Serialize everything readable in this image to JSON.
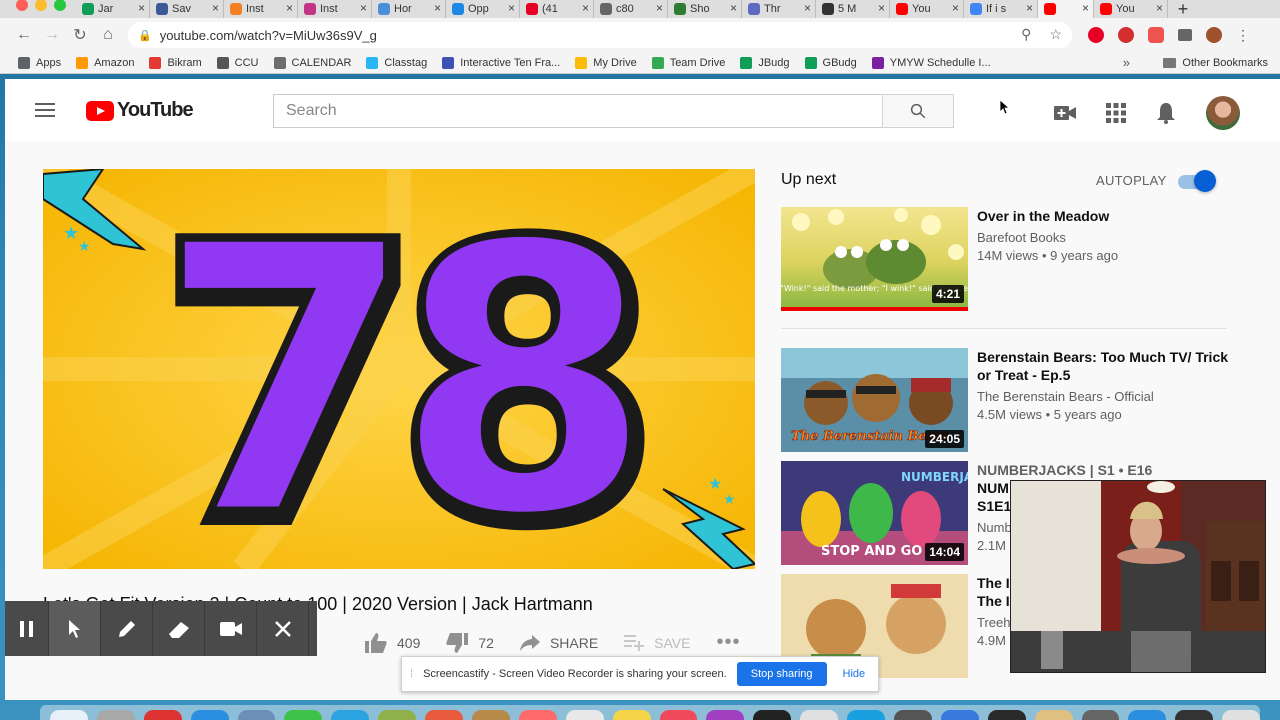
{
  "browser": {
    "tabs": [
      {
        "label": "Jar",
        "color": "#0f9d58"
      },
      {
        "label": "Sav",
        "color": "#3b5998"
      },
      {
        "label": "Inst",
        "color": "#f48024"
      },
      {
        "label": "Inst",
        "color": "#c13584"
      },
      {
        "label": "Hor",
        "color": "#4a90d9"
      },
      {
        "label": "Opp",
        "color": "#1e88e5"
      },
      {
        "label": "(41",
        "color": "#e60023"
      },
      {
        "label": "c80",
        "color": "#666666"
      },
      {
        "label": "Sho",
        "color": "#2e7d32"
      },
      {
        "label": "Thr",
        "color": "#5c6bc0"
      },
      {
        "label": "5 M",
        "color": "#333333"
      },
      {
        "label": "You",
        "color": "#ff0000"
      },
      {
        "label": "If i s",
        "color": "#4285f4"
      },
      {
        "label": "",
        "color": "#ff0000"
      },
      {
        "label": "You",
        "color": "#ff0000"
      }
    ],
    "url": "youtube.com/watch?v=MiUw36s9V_g",
    "bookmarks": [
      {
        "label": "Apps",
        "color": "#5f6368"
      },
      {
        "label": "Amazon",
        "color": "#ff9900"
      },
      {
        "label": "Bikram",
        "color": "#e53935"
      },
      {
        "label": "CCU",
        "color": "#555555"
      },
      {
        "label": "CALENDAR",
        "color": "#6d6d6d"
      },
      {
        "label": "Classtag",
        "color": "#29b6f6"
      },
      {
        "label": "Interactive Ten Fra...",
        "color": "#3f51b5"
      },
      {
        "label": "My Drive",
        "color": "#fbbc05"
      },
      {
        "label": "Team Drive",
        "color": "#34a853"
      },
      {
        "label": "JBudg",
        "color": "#0f9d58"
      },
      {
        "label": "GBudg",
        "color": "#0f9d58"
      },
      {
        "label": "YMYW Schedulle I...",
        "color": "#7b1fa2"
      }
    ],
    "bookmarks_more": "»",
    "other_bookmarks": "Other Bookmarks"
  },
  "youtube": {
    "logo_text": "YouTube",
    "search_placeholder": "Search",
    "video_number": "78",
    "video_title": "Let's Get Fit Version 2 | Count to 100 | 2020 Version | Jack Hartmann",
    "likes": "409",
    "dislikes": "72",
    "share_label": "SHARE",
    "save_label": "SAVE",
    "up_next": "Up next",
    "autoplay_label": "AUTOPLAY",
    "autoplay_on": true,
    "videos": [
      {
        "title": "Over in the Meadow",
        "channel": "Barefoot Books",
        "stats": "14M views • 9 years ago",
        "duration": "4:21",
        "thumb_caption": "\"Wink!\" said the mother; \"I wink!\" said the one"
      },
      {
        "title": "Berenstain Bears: Too Much TV/ Trick or Treat - Ep.5",
        "channel": "The Berenstain Bears - Official",
        "stats": "4.5M views • 5 years ago",
        "duration": "24:05",
        "thumb_caption": "The Berenstain Bears"
      },
      {
        "title": "NUMBERJACKS | S1 • E16",
        "title_line2": "NUM",
        "title_line3": "S1E1",
        "channel": "Numb",
        "stats": "2.1M",
        "duration": "14:04",
        "thumb_caption": "STOP AND GO",
        "thumb_brand": "NUMBERJACKS"
      },
      {
        "title": "The I",
        "title_line2": "The I",
        "channel": "Treeh",
        "stats": "4.9M",
        "duration": ""
      }
    ]
  },
  "screencastify": {
    "message": "Screencastify - Screen Video Recorder is sharing your screen.",
    "stop_label": "Stop sharing",
    "hide_label": "Hide"
  }
}
